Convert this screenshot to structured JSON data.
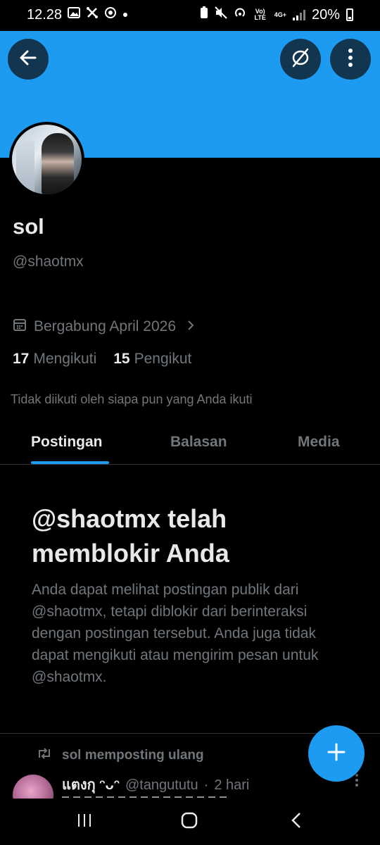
{
  "status_bar": {
    "time": "12.28",
    "network_label": "4G+",
    "lte_label": "Vo) LTE",
    "battery": "20%"
  },
  "profile": {
    "name": "sol",
    "handle": "@shaotmx",
    "joined": "Bergabung April 2026",
    "following_count": "17",
    "following_label": "Mengikuti",
    "followers_count": "15",
    "followers_label": "Pengikut",
    "not_followed_text": "Tidak diikuti oleh siapa pun yang Anda ikuti"
  },
  "tabs": [
    {
      "label": "Postingan"
    },
    {
      "label": "Balasan"
    },
    {
      "label": "Media"
    }
  ],
  "blocked": {
    "title": "@shaotmx telah memblokir Anda",
    "description": "Anda dapat melihat postingan publik dari @shaotmx, tetapi diblokir dari berinteraksi dengan postingan tersebut. Anda juga tidak dapat mengikuti atau mengirim pesan untuk @shaotmx."
  },
  "post": {
    "repost_label": "sol memposting ulang",
    "author_name": "แตงกุ ᵔᴗᵔ",
    "author_handle": "@tangututu",
    "separator": "·",
    "time": "2 hari"
  },
  "colors": {
    "accent": "#1d9bf0",
    "background": "#000000",
    "text_primary": "#e7e9ea",
    "text_secondary": "#71767b"
  },
  "icons": {
    "back": "arrow-left-icon",
    "block": "block-icon",
    "more": "more-vertical-icon",
    "calendar": "calendar-icon",
    "repost": "repost-icon",
    "compose": "plus-icon"
  }
}
